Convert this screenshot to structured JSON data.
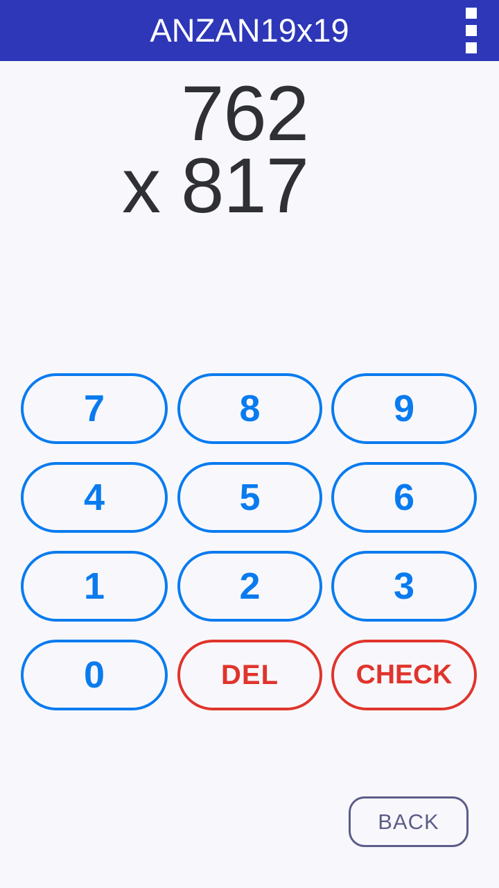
{
  "app": {
    "title": "ANZAN19x19",
    "header_color": "#2d37b8",
    "background_color": "#f8f8fc",
    "overflow_menu_label": "More options"
  },
  "problem": {
    "multiplicand": "762",
    "operator": "x",
    "multiplier": "817",
    "line1": "762",
    "line2": "x 817",
    "text_color": "#2f3033"
  },
  "keypad": {
    "accent_color": "#0a7bef",
    "danger_color": "#e0342c",
    "rows": [
      {
        "keys": [
          {
            "label": "7",
            "kind": "digit"
          },
          {
            "label": "8",
            "kind": "digit"
          },
          {
            "label": "9",
            "kind": "digit"
          }
        ]
      },
      {
        "keys": [
          {
            "label": "4",
            "kind": "digit"
          },
          {
            "label": "5",
            "kind": "digit"
          },
          {
            "label": "6",
            "kind": "digit"
          }
        ]
      },
      {
        "keys": [
          {
            "label": "1",
            "kind": "digit"
          },
          {
            "label": "2",
            "kind": "digit"
          },
          {
            "label": "3",
            "kind": "digit"
          }
        ]
      },
      {
        "keys": [
          {
            "label": "0",
            "kind": "digit"
          },
          {
            "label": "DEL",
            "kind": "action"
          },
          {
            "label": "CHECK",
            "kind": "action"
          }
        ]
      }
    ]
  },
  "footer": {
    "back_label": "BACK",
    "back_color": "#5c5c8a"
  }
}
